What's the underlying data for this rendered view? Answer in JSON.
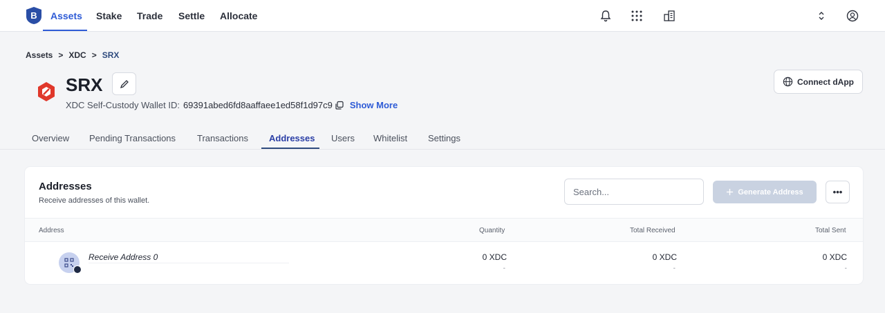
{
  "nav": {
    "logo_letter": "B",
    "items": [
      {
        "label": "Assets",
        "active": true
      },
      {
        "label": "Stake",
        "active": false
      },
      {
        "label": "Trade",
        "active": false
      },
      {
        "label": "Settle",
        "active": false
      },
      {
        "label": "Allocate",
        "active": false
      }
    ],
    "icons": [
      "bell-icon",
      "apps-grid-icon",
      "building-icon",
      "chevron-updown-icon",
      "user-circle-icon"
    ]
  },
  "breadcrumb": [
    "Assets",
    "XDC",
    "SRX"
  ],
  "breadcrumb_sep": ">",
  "asset": {
    "title": "SRX",
    "wallet_label": "XDC Self-Custody Wallet ID:",
    "wallet_id": "69391abed6fd8aaffaee1ed58f1d97c9",
    "show_more": "Show More"
  },
  "connect_dapp": "Connect dApp",
  "tabs": [
    {
      "label": "Overview",
      "active": false
    },
    {
      "label": "Pending Transactions",
      "active": false
    },
    {
      "label": "Transactions",
      "active": false
    },
    {
      "label": "Addresses",
      "active": true
    },
    {
      "label": "Users",
      "active": false
    },
    {
      "label": "Whitelist",
      "active": false
    },
    {
      "label": "Settings",
      "active": false
    }
  ],
  "addresses": {
    "title": "Addresses",
    "subtitle": "Receive addresses of this wallet.",
    "search_placeholder": "Search...",
    "generate_label": "Generate Address",
    "more_label": "•••",
    "columns": [
      "Address",
      "Quantity",
      "Total Received",
      "Total Sent"
    ],
    "rows": [
      {
        "label": "Receive Address 0",
        "quantity": "0 XDC",
        "quantity_sub": "-",
        "received": "0 XDC",
        "received_sub": "-",
        "sent": "0 XDC",
        "sent_sub": "-"
      }
    ]
  },
  "colors": {
    "accent": "#2e5bd6",
    "logo": "#2a4ea6",
    "asset_icon": "#e0382b",
    "disabled_button": "#c9d2e1"
  }
}
